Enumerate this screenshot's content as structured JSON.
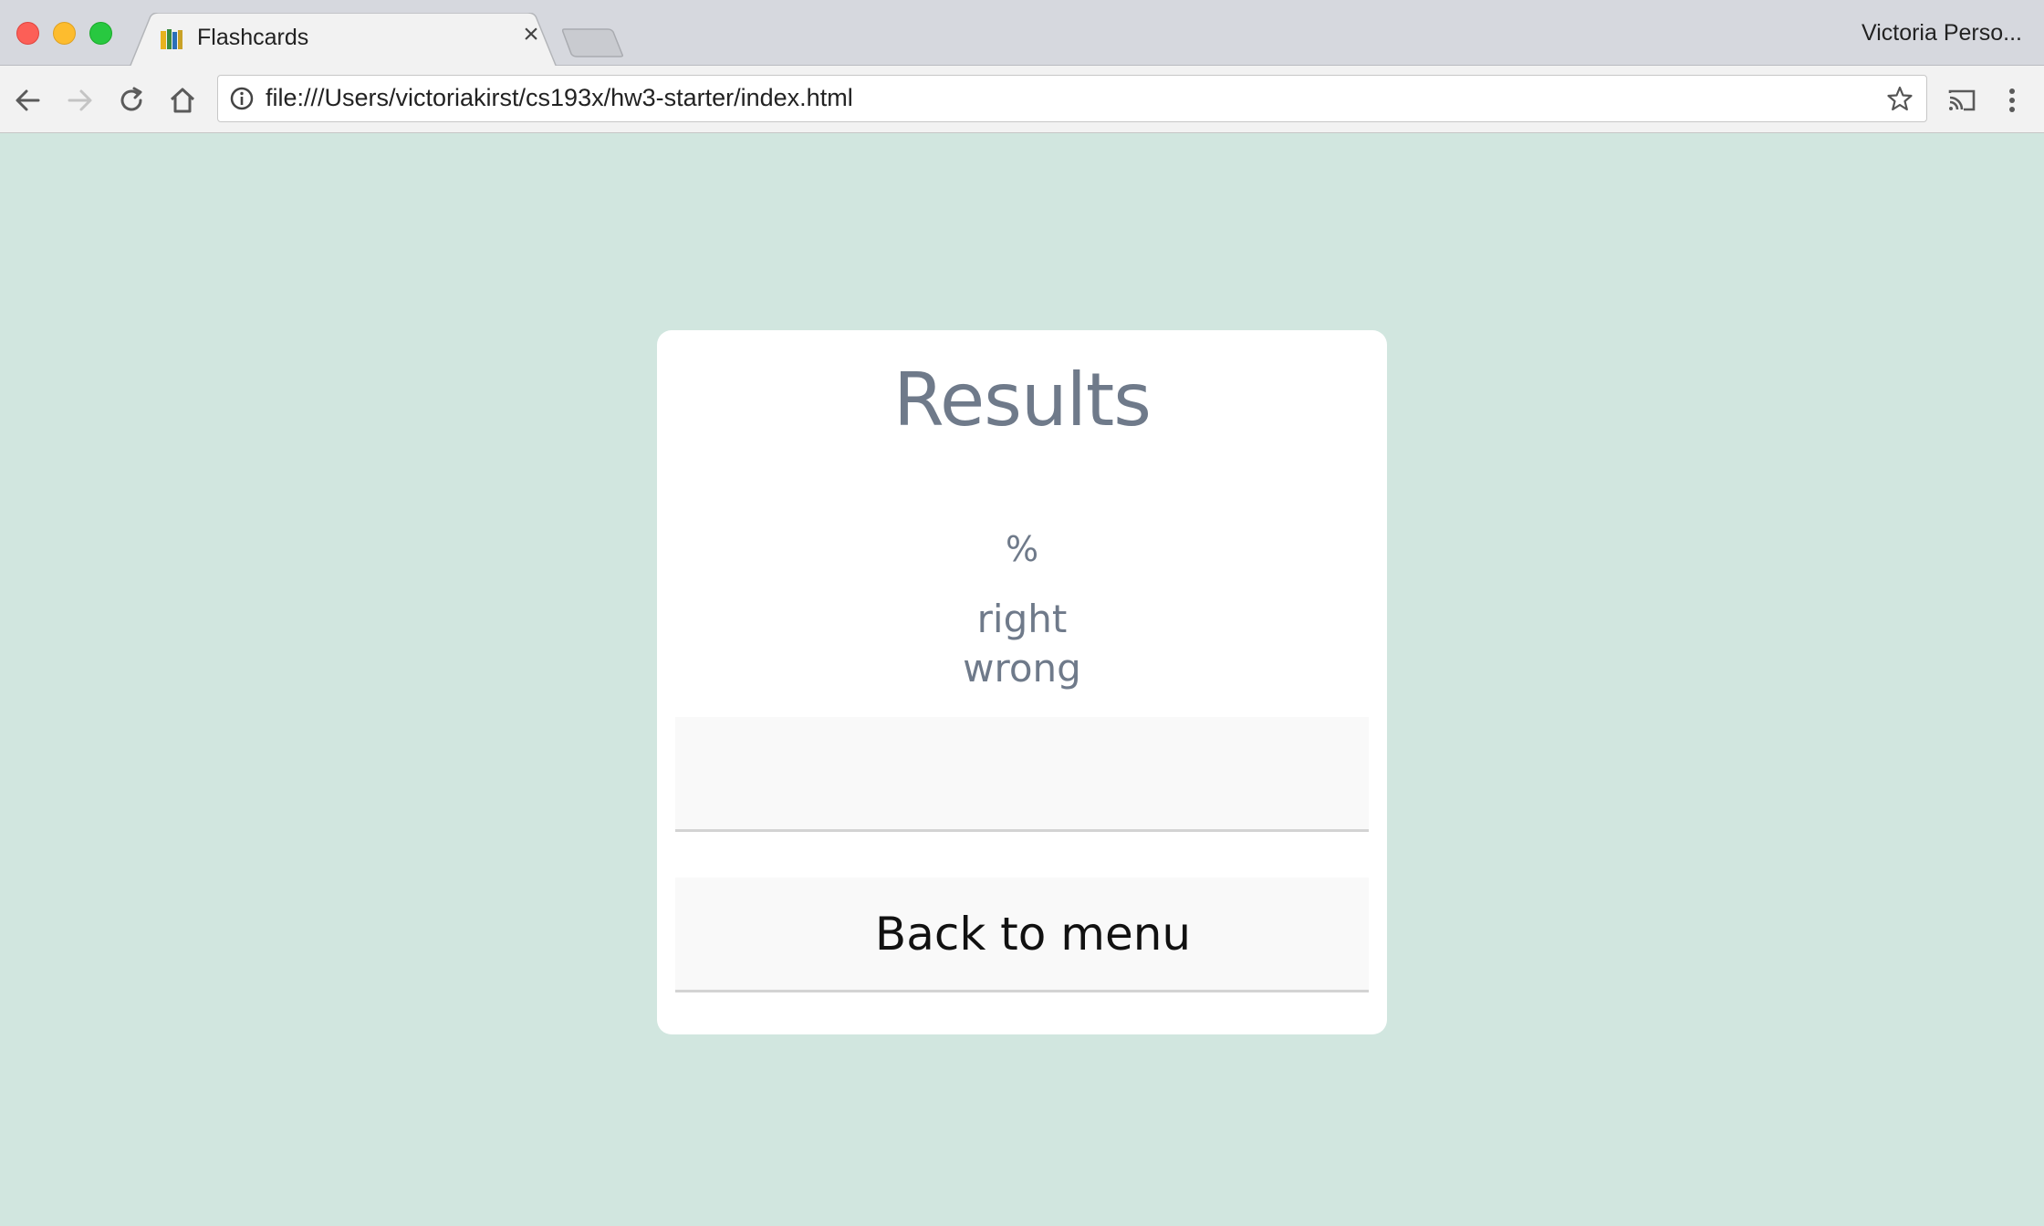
{
  "browser": {
    "tab_title": "Flashcards",
    "tab_close": "×",
    "profile_name": "Victoria Perso...",
    "url": "file:///Users/victoriakirst/cs193x/hw3-starter/index.html"
  },
  "results": {
    "title": "Results",
    "percent": "%",
    "right_label": "right",
    "wrong_label": "wrong",
    "continue_label": "",
    "menu_label": "Back to menu"
  },
  "colors": {
    "page_background": "#d1e6df",
    "card_background": "#ffffff",
    "text_muted": "#6f7a8a"
  }
}
